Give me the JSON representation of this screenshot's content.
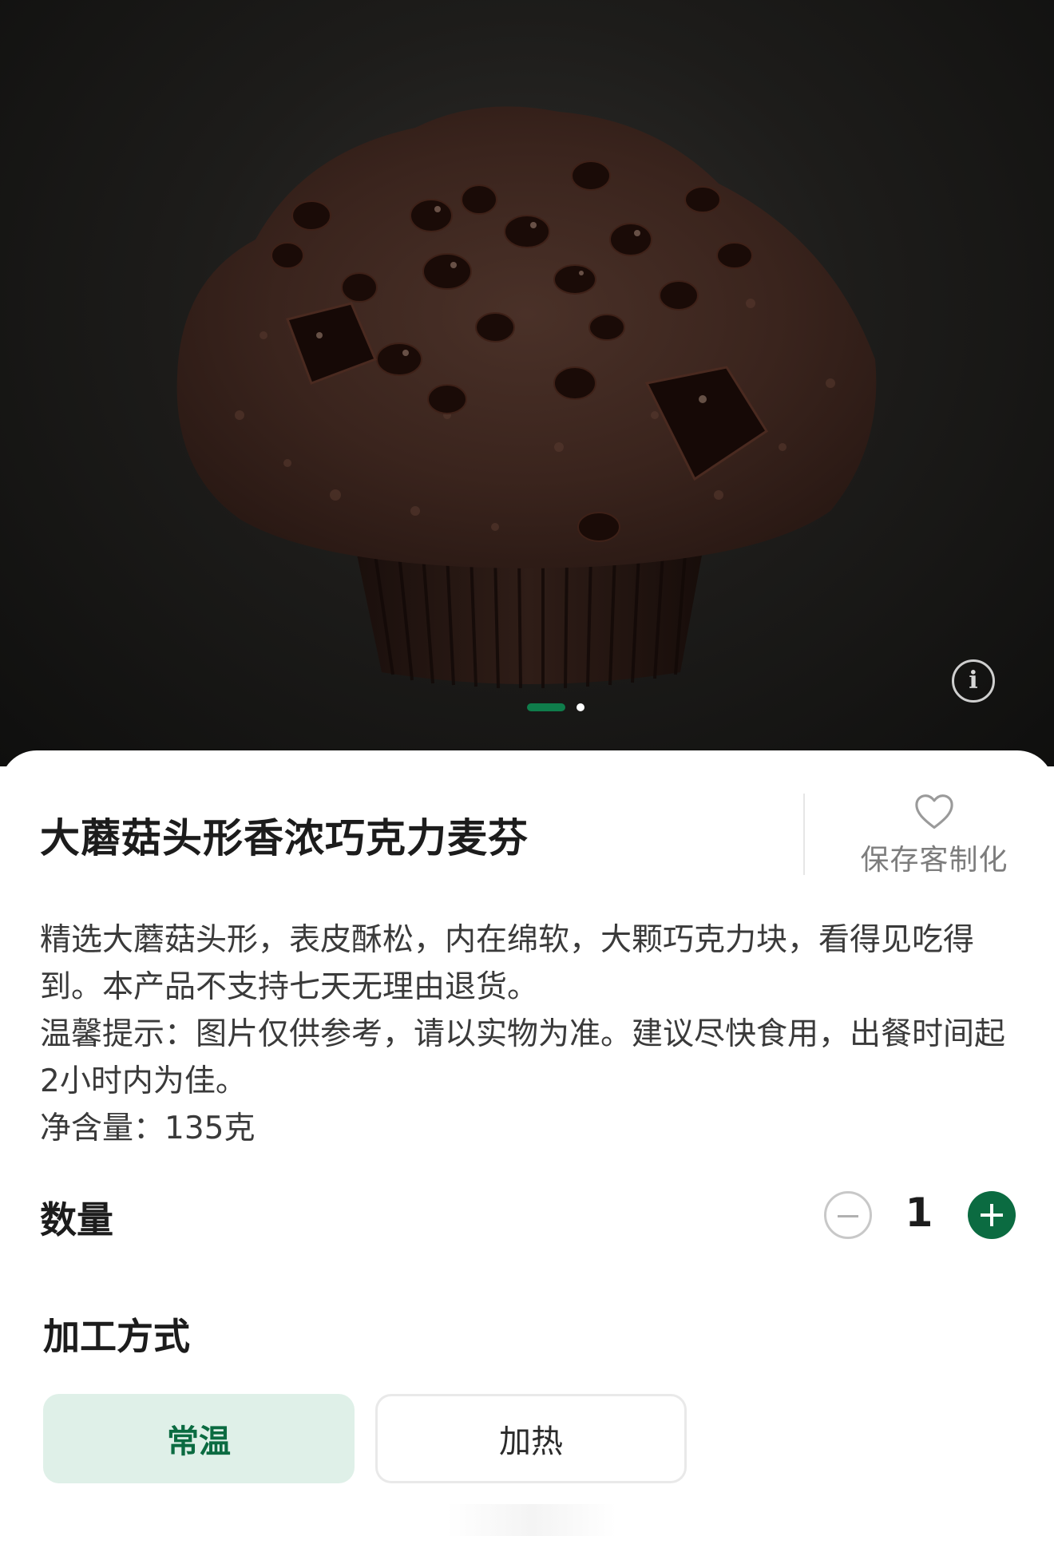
{
  "product": {
    "title": "大蘑菇头形香浓巧克力麦芬",
    "save_label": "保存客制化",
    "description": [
      "精选大蘑菇头形，表皮酥松，内在绵软，大颗巧克力块，看得见吃得到。本产品不支持七天无理由退货。",
      "温馨提示：图片仅供参考，请以实物为准。建议尽快食用，出餐时间起2小时内为佳。",
      "净含量：135克"
    ]
  },
  "gallery": {
    "image_subject": "chocolate muffin",
    "info_icon": "info-icon",
    "pages": 2,
    "active_page": 1
  },
  "quantity": {
    "label": "数量",
    "value": "1"
  },
  "processing": {
    "label": "加工方式",
    "options": [
      "常温",
      "加热"
    ],
    "selected": "常温"
  },
  "colors": {
    "accent": "#0b6b41",
    "selected_bg": "#dff0e8"
  }
}
